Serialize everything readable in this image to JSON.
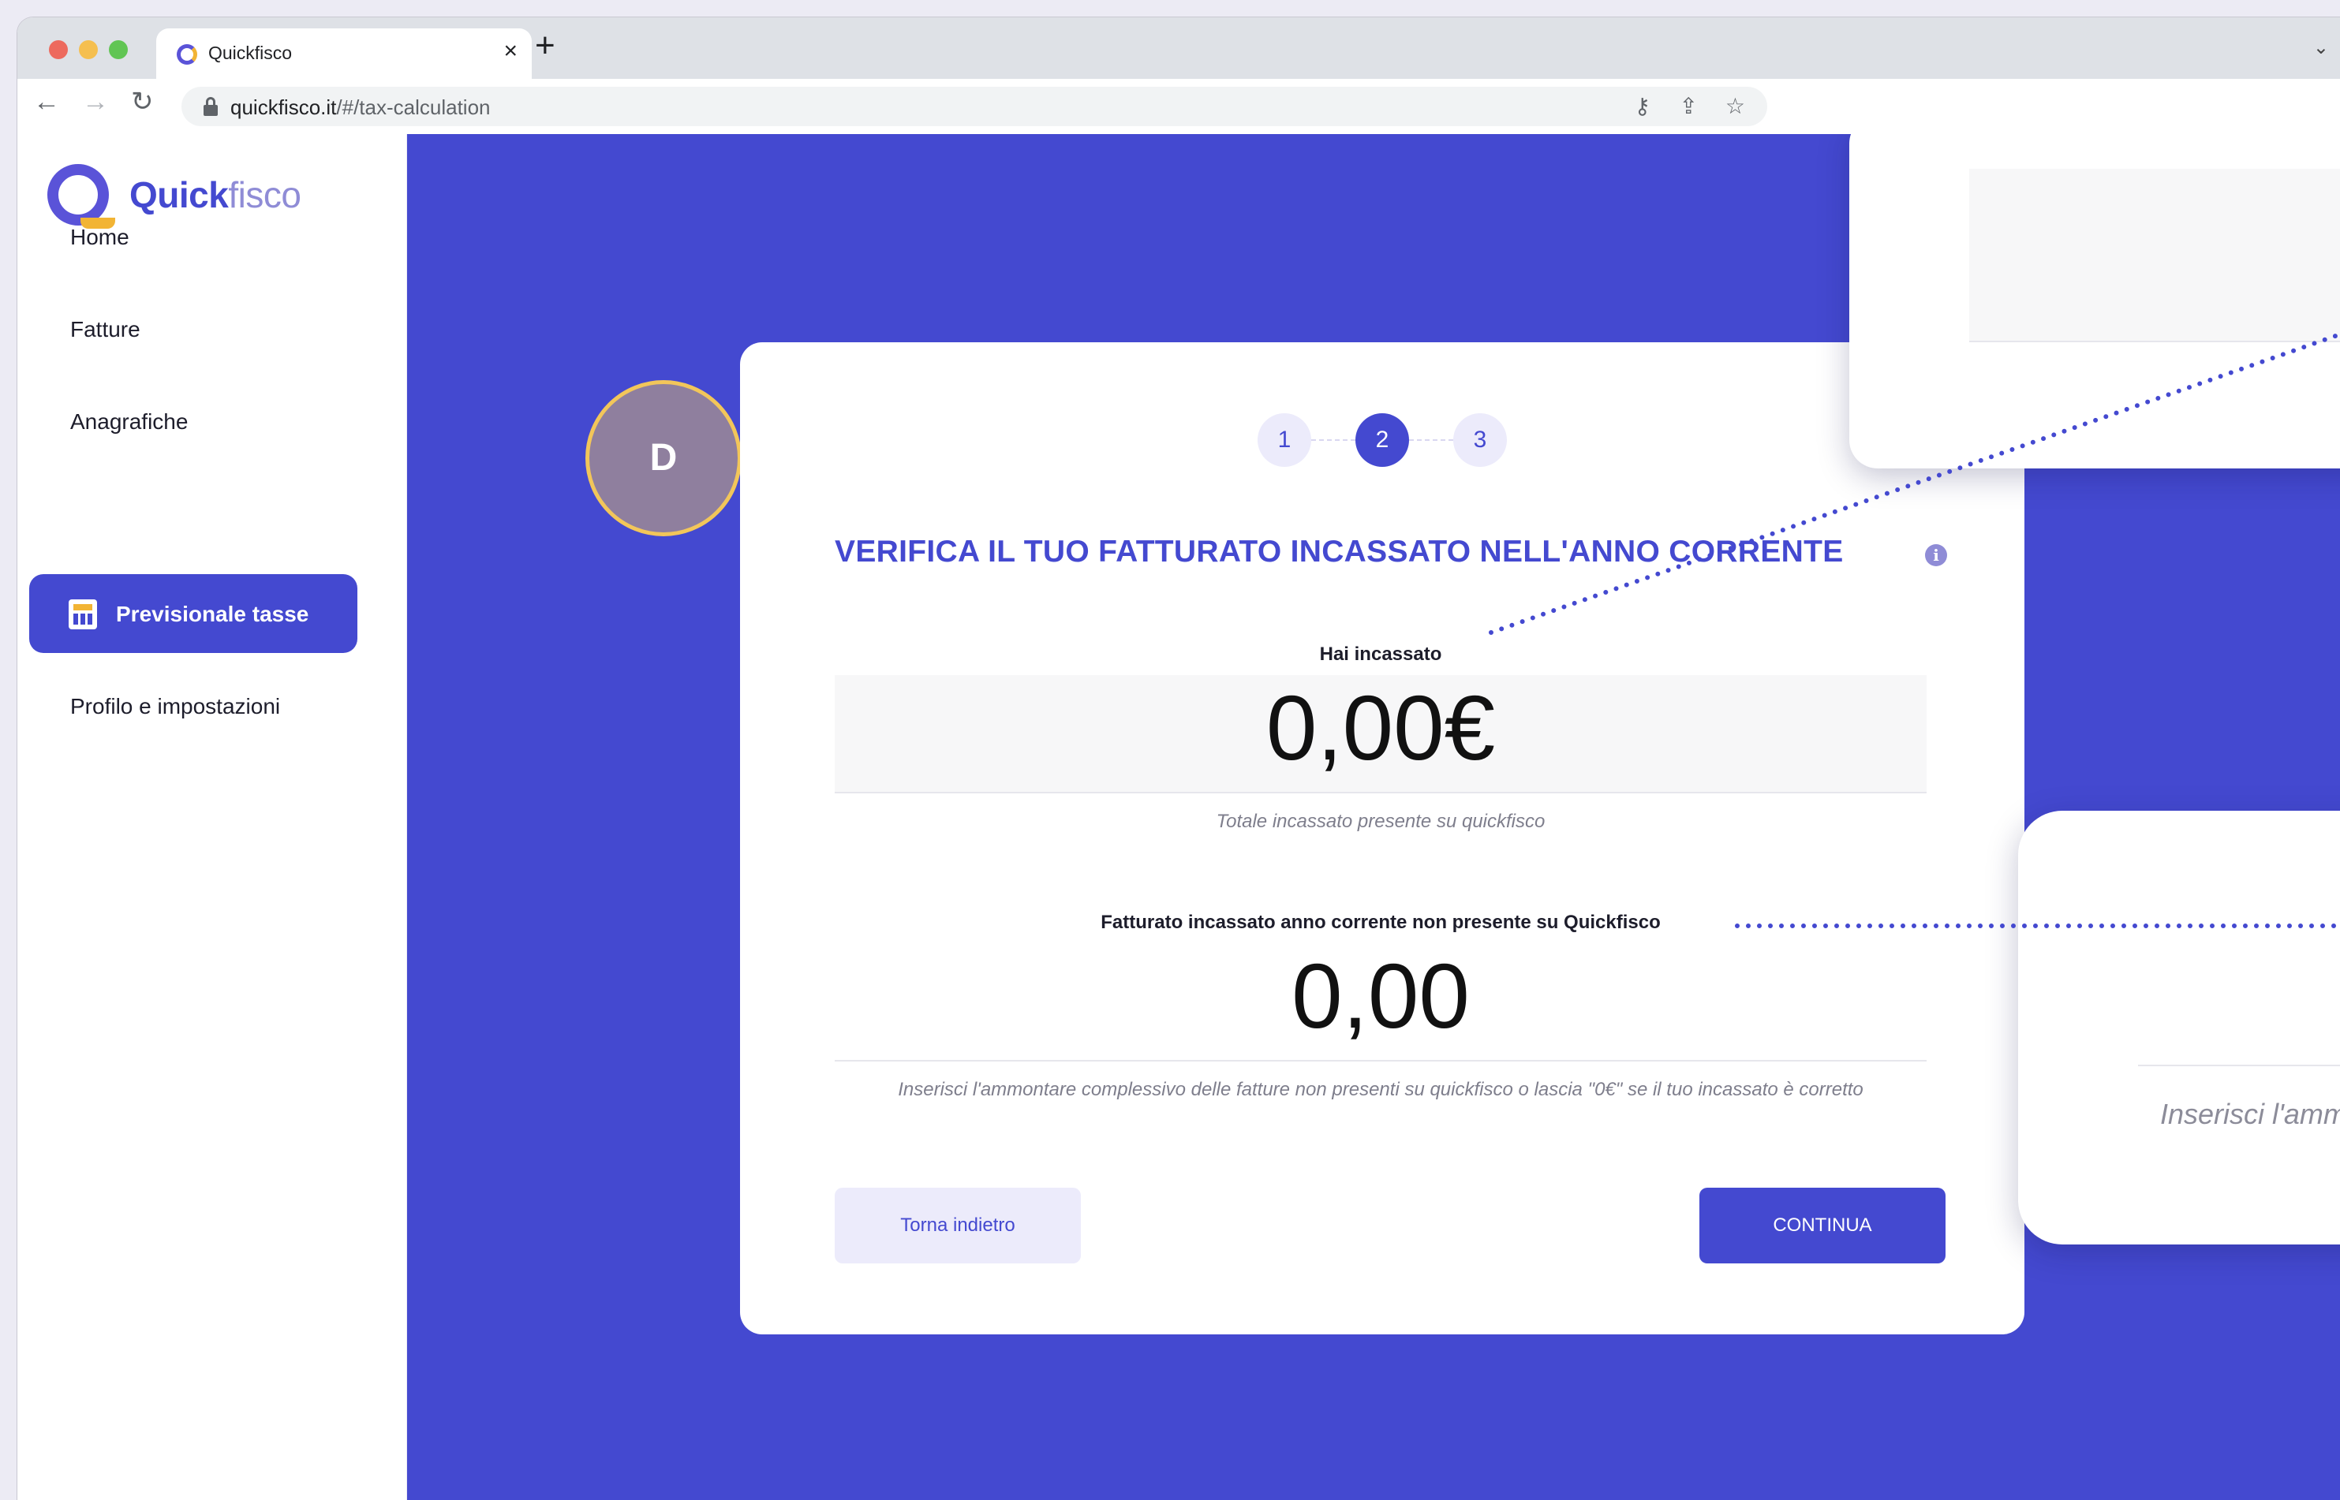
{
  "browser": {
    "tab_title": "Quickfisco",
    "url_host": "quickfisco.it",
    "url_path": "/#/tax-calculation"
  },
  "sidebar": {
    "logo": {
      "part1": "Quick",
      "part2": "fisco"
    },
    "items": [
      {
        "label": "Home",
        "active": false
      },
      {
        "label": "Fatture",
        "active": false
      },
      {
        "label": "Anagrafiche",
        "active": false
      },
      {
        "label": "Previsionale tasse",
        "active": true,
        "icon": "calculator-icon"
      },
      {
        "label": "Profilo e impostazioni",
        "active": false
      }
    ]
  },
  "avatar": {
    "initial": "D"
  },
  "stepper": {
    "steps": [
      "1",
      "2",
      "3"
    ],
    "current": 2
  },
  "form": {
    "title": "VERIFICA IL TUO FATTURATO INCASSATO NELL'ANNO CORRENTE",
    "collected": {
      "label": "Hai incassato",
      "value": "0,00€",
      "hint": "Totale incassato presente su quickfisco"
    },
    "extra": {
      "label": "Fatturato incassato anno corrente non presente su Quickfisco",
      "value": "0,00",
      "hint": "Inserisci l'ammontare complessivo delle fatture non presenti su quickfisco o lascia \"0€\" se il tuo incassato è corretto"
    },
    "back_label": "Torna indietro",
    "continue_label": "CONTINUA"
  },
  "zoom": {
    "bottom_text": "Inserisci l'amm"
  },
  "colors": {
    "brand": "#4449d0",
    "accent": "#f2b434",
    "avatar": "#8f7f9e"
  }
}
